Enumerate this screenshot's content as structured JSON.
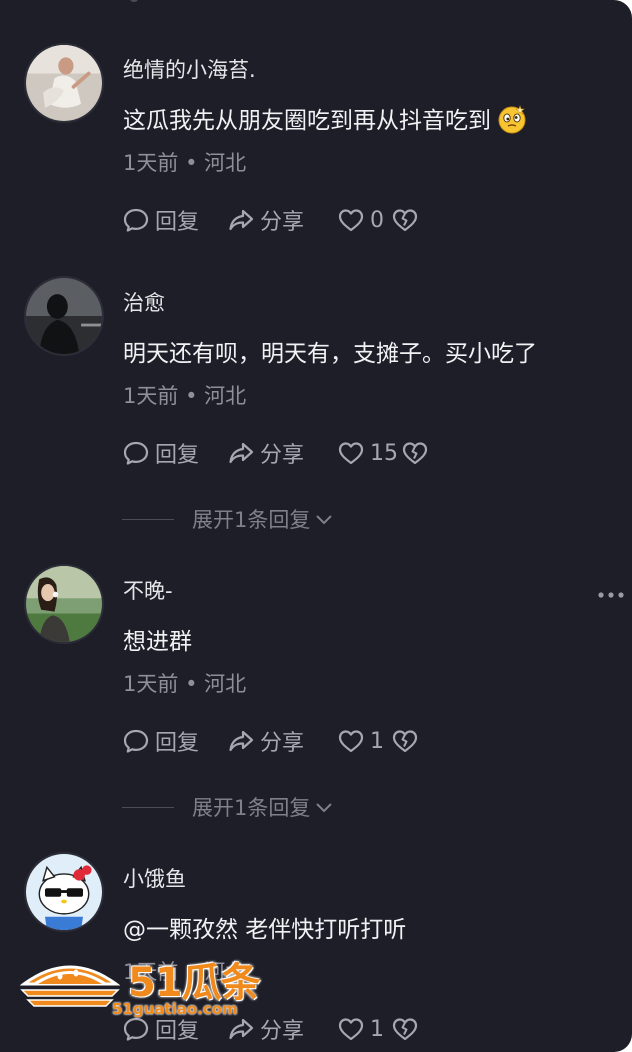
{
  "comments": [
    {
      "username": "绝情的小海苔.",
      "text": "这瓜我先从朋友圈吃到再从抖音吃到",
      "emoji": "dizzy-face-emoji",
      "time": "1天前",
      "location": "河北",
      "reply_label": "回复",
      "share_label": "分享",
      "likes": "0"
    },
    {
      "username": "治愈",
      "text": "明天还有呗，明天有，支摊子。买小吃了",
      "time": "1天前",
      "location": "河北",
      "reply_label": "回复",
      "share_label": "分享",
      "likes": "15",
      "expand_label": "展开1条回复"
    },
    {
      "username": "不晚-",
      "text": "想进群",
      "time": "1天前",
      "location": "河北",
      "reply_label": "回复",
      "share_label": "分享",
      "likes": "1",
      "expand_label": "展开1条回复"
    },
    {
      "username": "小饿鱼",
      "text": "@一颗孜然 老伴快打听打听",
      "time": "1天前",
      "location": "河北",
      "reply_label": "回复",
      "share_label": "分享",
      "likes": "1"
    }
  ],
  "meta_separator": "•",
  "watermark": {
    "brand": "51瓜条",
    "url": "51guatiao.com"
  },
  "colors": {
    "background": "#1d1e27",
    "text": "#f2f2f5",
    "muted": "#8e8f99",
    "watermark": "#f08a1c"
  }
}
